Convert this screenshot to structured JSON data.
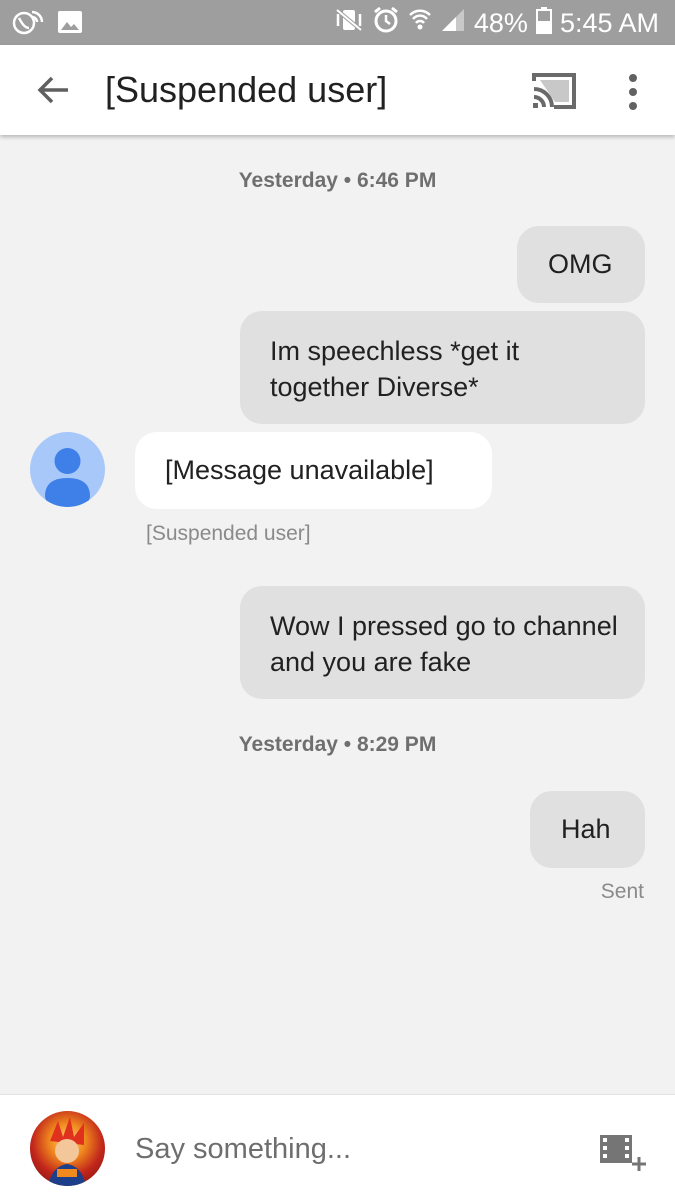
{
  "status_bar": {
    "battery": "48%",
    "time": "5:45 AM"
  },
  "header": {
    "title": "[Suspended user]",
    "icons": [
      "back-arrow-icon",
      "cast-icon",
      "more-vert-icon"
    ]
  },
  "conversation": {
    "timestamps": [
      "Yesterday • 6:46 PM",
      "Yesterday • 8:29 PM"
    ],
    "messages": [
      {
        "direction": "outgoing",
        "text": "OMG"
      },
      {
        "direction": "outgoing",
        "text": "Im speechless  *get it together Diverse*"
      },
      {
        "direction": "incoming",
        "text": "[Message unavailable]",
        "sender": "[Suspended user]"
      },
      {
        "direction": "outgoing",
        "text": "Wow I pressed go to channel and you are fake"
      },
      {
        "direction": "outgoing",
        "text": "Hah",
        "status": "Sent"
      }
    ]
  },
  "compose": {
    "placeholder": "Say something...",
    "icons": [
      "self-avatar",
      "add-media-icon"
    ]
  },
  "colors": {
    "status_bar": "#9e9e9e",
    "app_bar": "#ffffff",
    "background": "#f2f2f2",
    "outgoing_bubble": "#e0e0e0",
    "incoming_bubble": "#ffffff",
    "avatar": "#a8c8fa",
    "avatar_figure": "#3f7fe8"
  }
}
